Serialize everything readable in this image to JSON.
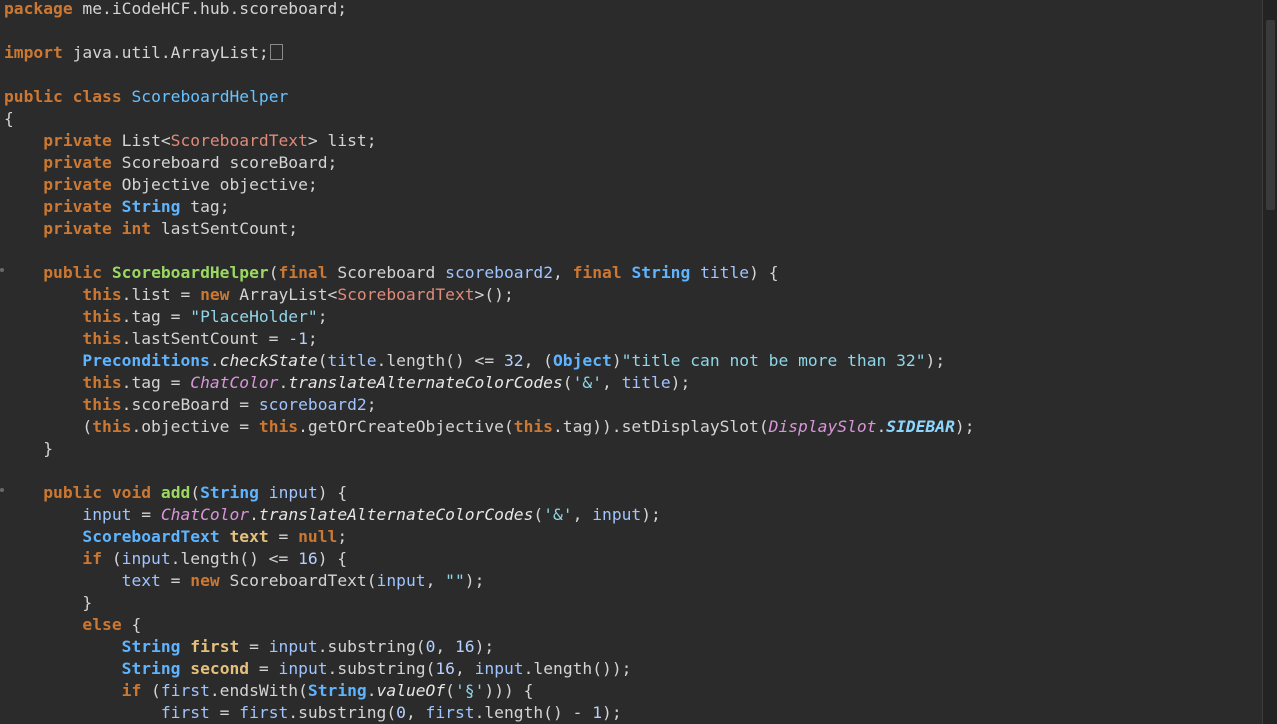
{
  "colors": {
    "background": "#2b2b2b",
    "keyword": "#cc7832",
    "class_name": "#66c2ff",
    "method_decl": "#9bd862",
    "string": "#8fd6e8"
  },
  "code": {
    "lines": [
      [
        [
          "pkg",
          "package"
        ],
        [
          "plain",
          " me.iCodeHCF.hub.scoreboard;"
        ]
      ],
      [],
      [
        [
          "kw",
          "import"
        ],
        [
          "plain",
          " java.util.ArrayList;"
        ],
        [
          "foldbox",
          ""
        ]
      ],
      [],
      [
        [
          "kw",
          "public"
        ],
        [
          "plain",
          " "
        ],
        [
          "kw",
          "class"
        ],
        [
          "plain",
          " "
        ],
        [
          "cls",
          "ScoreboardHelper"
        ]
      ],
      [
        [
          "plain",
          "{"
        ]
      ],
      [
        [
          "plain",
          "    "
        ],
        [
          "kw",
          "private"
        ],
        [
          "plain",
          " "
        ],
        [
          "plain",
          "List<"
        ],
        [
          "gen",
          "ScoreboardText"
        ],
        [
          "plain",
          "> list;"
        ]
      ],
      [
        [
          "plain",
          "    "
        ],
        [
          "kw",
          "private"
        ],
        [
          "plain",
          " Scoreboard scoreBoard;"
        ]
      ],
      [
        [
          "plain",
          "    "
        ],
        [
          "kw",
          "private"
        ],
        [
          "plain",
          " Objective objective;"
        ]
      ],
      [
        [
          "plain",
          "    "
        ],
        [
          "kw",
          "private"
        ],
        [
          "plain",
          " "
        ],
        [
          "typ",
          "String"
        ],
        [
          "plain",
          " tag;"
        ]
      ],
      [
        [
          "plain",
          "    "
        ],
        [
          "kw",
          "private"
        ],
        [
          "plain",
          " "
        ],
        [
          "kw",
          "int"
        ],
        [
          "plain",
          " lastSentCount;"
        ]
      ],
      [],
      [
        [
          "plain",
          "    "
        ],
        [
          "kw",
          "public"
        ],
        [
          "plain",
          " "
        ],
        [
          "fn",
          "ScoreboardHelper"
        ],
        [
          "plain",
          "("
        ],
        [
          "kw",
          "final"
        ],
        [
          "plain",
          " Scoreboard "
        ],
        [
          "par",
          "scoreboard2"
        ],
        [
          "plain",
          ", "
        ],
        [
          "kw",
          "final"
        ],
        [
          "plain",
          " "
        ],
        [
          "typ",
          "String"
        ],
        [
          "plain",
          " "
        ],
        [
          "par",
          "title"
        ],
        [
          "plain",
          ") {"
        ]
      ],
      [
        [
          "plain",
          "        "
        ],
        [
          "kw",
          "this"
        ],
        [
          "plain",
          ".list = "
        ],
        [
          "kw",
          "new"
        ],
        [
          "plain",
          " ArrayList<"
        ],
        [
          "gen",
          "ScoreboardText"
        ],
        [
          "plain",
          ">();"
        ]
      ],
      [
        [
          "plain",
          "        "
        ],
        [
          "kw",
          "this"
        ],
        [
          "plain",
          ".tag = "
        ],
        [
          "str",
          "\"PlaceHolder\""
        ],
        [
          "plain",
          ";"
        ]
      ],
      [
        [
          "plain",
          "        "
        ],
        [
          "kw",
          "this"
        ],
        [
          "plain",
          ".lastSentCount = "
        ],
        [
          "num",
          "-1"
        ],
        [
          "plain",
          ";"
        ]
      ],
      [
        [
          "plain",
          "        "
        ],
        [
          "typ",
          "Preconditions"
        ],
        [
          "plain",
          "."
        ],
        [
          "mi",
          "checkState"
        ],
        [
          "plain",
          "("
        ],
        [
          "par",
          "title"
        ],
        [
          "plain",
          ".length() <= "
        ],
        [
          "num",
          "32"
        ],
        [
          "plain",
          ", ("
        ],
        [
          "typ",
          "Object"
        ],
        [
          "plain",
          ")"
        ],
        [
          "str",
          "\"title can not be more than 32\""
        ],
        [
          "plain",
          ");"
        ]
      ],
      [
        [
          "plain",
          "        "
        ],
        [
          "kw",
          "this"
        ],
        [
          "plain",
          ".tag = "
        ],
        [
          "it",
          "ChatColor"
        ],
        [
          "plain",
          "."
        ],
        [
          "mi",
          "translateAlternateColorCodes"
        ],
        [
          "plain",
          "("
        ],
        [
          "str",
          "'&'"
        ],
        [
          "plain",
          ", "
        ],
        [
          "par",
          "title"
        ],
        [
          "plain",
          ");"
        ]
      ],
      [
        [
          "plain",
          "        "
        ],
        [
          "kw",
          "this"
        ],
        [
          "plain",
          ".scoreBoard = "
        ],
        [
          "par",
          "scoreboard2"
        ],
        [
          "plain",
          ";"
        ]
      ],
      [
        [
          "plain",
          "        ("
        ],
        [
          "kw",
          "this"
        ],
        [
          "plain",
          ".objective = "
        ],
        [
          "kw",
          "this"
        ],
        [
          "plain",
          ".getOrCreateObjective("
        ],
        [
          "kw",
          "this"
        ],
        [
          "plain",
          ".tag)).setDisplaySlot("
        ],
        [
          "it",
          "DisplaySlot"
        ],
        [
          "plain",
          "."
        ],
        [
          "bi",
          "SIDEBAR"
        ],
        [
          "plain",
          ");"
        ]
      ],
      [
        [
          "plain",
          "    }"
        ]
      ],
      [],
      [
        [
          "plain",
          "    "
        ],
        [
          "kw",
          "public"
        ],
        [
          "plain",
          " "
        ],
        [
          "kw",
          "void"
        ],
        [
          "plain",
          " "
        ],
        [
          "fn",
          "add"
        ],
        [
          "plain",
          "("
        ],
        [
          "typ",
          "String"
        ],
        [
          "plain",
          " "
        ],
        [
          "par",
          "input"
        ],
        [
          "plain",
          ") {"
        ]
      ],
      [
        [
          "plain",
          "        "
        ],
        [
          "par",
          "input"
        ],
        [
          "plain",
          " = "
        ],
        [
          "it",
          "ChatColor"
        ],
        [
          "plain",
          "."
        ],
        [
          "mi",
          "translateAlternateColorCodes"
        ],
        [
          "plain",
          "("
        ],
        [
          "str",
          "'&'"
        ],
        [
          "plain",
          ", "
        ],
        [
          "par",
          "input"
        ],
        [
          "plain",
          ");"
        ]
      ],
      [
        [
          "plain",
          "        "
        ],
        [
          "typ",
          "ScoreboardText"
        ],
        [
          "plain",
          " "
        ],
        [
          "loc",
          "text"
        ],
        [
          "plain",
          " = "
        ],
        [
          "kw",
          "null"
        ],
        [
          "plain",
          ";"
        ]
      ],
      [
        [
          "plain",
          "        "
        ],
        [
          "kw",
          "if"
        ],
        [
          "plain",
          " ("
        ],
        [
          "par",
          "input"
        ],
        [
          "plain",
          ".length() <= "
        ],
        [
          "num",
          "16"
        ],
        [
          "plain",
          ") {"
        ]
      ],
      [
        [
          "plain",
          "            "
        ],
        [
          "par",
          "text"
        ],
        [
          "plain",
          " = "
        ],
        [
          "kw",
          "new"
        ],
        [
          "plain",
          " ScoreboardText("
        ],
        [
          "par",
          "input"
        ],
        [
          "plain",
          ", "
        ],
        [
          "str",
          "\"\""
        ],
        [
          "plain",
          ");"
        ]
      ],
      [
        [
          "plain",
          "        }"
        ]
      ],
      [
        [
          "plain",
          "        "
        ],
        [
          "kw",
          "else"
        ],
        [
          "plain",
          " {"
        ]
      ],
      [
        [
          "plain",
          "            "
        ],
        [
          "typ",
          "String"
        ],
        [
          "plain",
          " "
        ],
        [
          "loc",
          "first"
        ],
        [
          "plain",
          " = "
        ],
        [
          "par",
          "input"
        ],
        [
          "plain",
          ".substring("
        ],
        [
          "num",
          "0"
        ],
        [
          "plain",
          ", "
        ],
        [
          "num",
          "16"
        ],
        [
          "plain",
          ");"
        ]
      ],
      [
        [
          "plain",
          "            "
        ],
        [
          "typ",
          "String"
        ],
        [
          "plain",
          " "
        ],
        [
          "loc",
          "second"
        ],
        [
          "plain",
          " = "
        ],
        [
          "par",
          "input"
        ],
        [
          "plain",
          ".substring("
        ],
        [
          "num",
          "16"
        ],
        [
          "plain",
          ", "
        ],
        [
          "par",
          "input"
        ],
        [
          "plain",
          ".length());"
        ]
      ],
      [
        [
          "plain",
          "            "
        ],
        [
          "kw",
          "if"
        ],
        [
          "plain",
          " ("
        ],
        [
          "par",
          "first"
        ],
        [
          "plain",
          ".endsWith("
        ],
        [
          "typ",
          "String"
        ],
        [
          "plain",
          "."
        ],
        [
          "mi",
          "valueOf"
        ],
        [
          "plain",
          "("
        ],
        [
          "str",
          "'§'"
        ],
        [
          "plain",
          "))) {"
        ]
      ],
      [
        [
          "plain",
          "                "
        ],
        [
          "par",
          "first"
        ],
        [
          "plain",
          " = "
        ],
        [
          "par",
          "first"
        ],
        [
          "plain",
          ".substring("
        ],
        [
          "num",
          "0"
        ],
        [
          "plain",
          ", "
        ],
        [
          "par",
          "first"
        ],
        [
          "plain",
          ".length() - "
        ],
        [
          "num",
          "1"
        ],
        [
          "plain",
          ");"
        ]
      ]
    ]
  }
}
